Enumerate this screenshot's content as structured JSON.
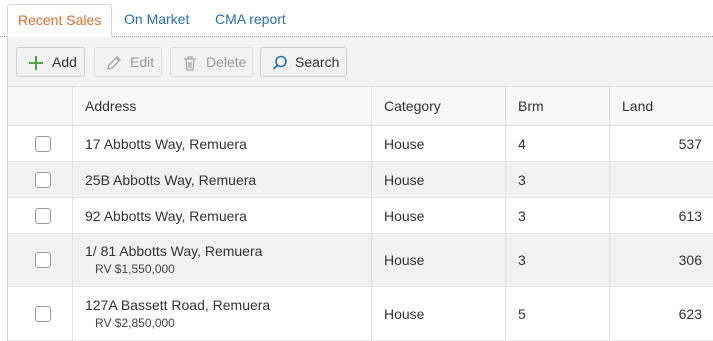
{
  "tabs": [
    {
      "label": "Recent Sales",
      "active": true
    },
    {
      "label": "On Market",
      "active": false
    },
    {
      "label": "CMA report",
      "active": false
    }
  ],
  "toolbar": {
    "add_label": "Add",
    "edit_label": "Edit",
    "delete_label": "Delete",
    "search_label": "Search"
  },
  "table": {
    "columns": [
      "Address",
      "Category",
      "Brm",
      "Land"
    ],
    "rows": [
      {
        "address": "17 Abbotts Way, Remuera",
        "rv": "",
        "category": "House",
        "brm": "4",
        "land": "537"
      },
      {
        "address": "25B Abbotts Way, Remuera",
        "rv": "",
        "category": "House",
        "brm": "3",
        "land": ""
      },
      {
        "address": "92 Abbotts Way, Remuera",
        "rv": "",
        "category": "House",
        "brm": "3",
        "land": "613"
      },
      {
        "address": "1/ 81 Abbotts Way, Remuera",
        "rv": "RV $1,550,000",
        "category": "House",
        "brm": "3",
        "land": "306"
      },
      {
        "address": "127A Bassett Road, Remuera",
        "rv": "RV $2,850,000",
        "category": "House",
        "brm": "5",
        "land": "623"
      }
    ]
  },
  "colors": {
    "active_tab": "#e06c2a",
    "link_tab": "#2a6fb0",
    "add_icon": "#3a9a3a",
    "search_icon": "#2a6fb0"
  }
}
